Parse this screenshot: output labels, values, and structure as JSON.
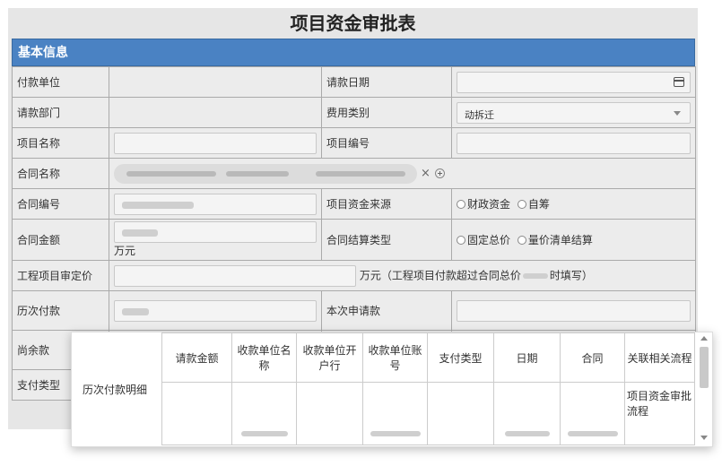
{
  "title": "项目资金审批表",
  "section": "基本信息",
  "rows": {
    "payer_label": "付款单位",
    "request_date_label": "请款日期",
    "dept_label": "请款部门",
    "fee_type_label": "费用类别",
    "fee_type_value": "动拆迁",
    "project_name_label": "项目名称",
    "project_no_label": "项目编号",
    "contract_name_label": "合同名称",
    "contract_no_label": "合同编号",
    "fund_source_label": "项目资金来源",
    "fund_source_opt1": "财政资金",
    "fund_source_opt2": "自筹",
    "contract_amount_label": "合同金额",
    "contract_amount_unit": "万元",
    "settle_type_label": "合同结算类型",
    "settle_opt1": "固定总价",
    "settle_opt2": "量价清单结算",
    "audit_price_label": "工程项目审定价",
    "audit_note": "万元（工程项目付款超过合同总价",
    "audit_note_tail": "时填写）",
    "history_pay_label": "历次付款",
    "this_request_label": "本次申请款",
    "balance_label": "尚余款",
    "pay_type_label": "支付类型"
  },
  "detail": {
    "label": "历次付款明细",
    "columns": [
      "请款金额",
      "收款单位名称",
      "收款单位开户行",
      "收款单位账号",
      "支付类型",
      "日期",
      "合同",
      "关联相关流程"
    ],
    "row_flow": "项目资金审批流程"
  },
  "colors": {
    "header_bg": "#4a82c3",
    "header_text": "#ffffff",
    "sheet_bg": "#e6e6e6"
  },
  "icons": [
    "calendar-icon",
    "chevron-down-icon",
    "close-icon",
    "add-circle-icon",
    "scroll-up-icon",
    "scroll-down-icon"
  ]
}
